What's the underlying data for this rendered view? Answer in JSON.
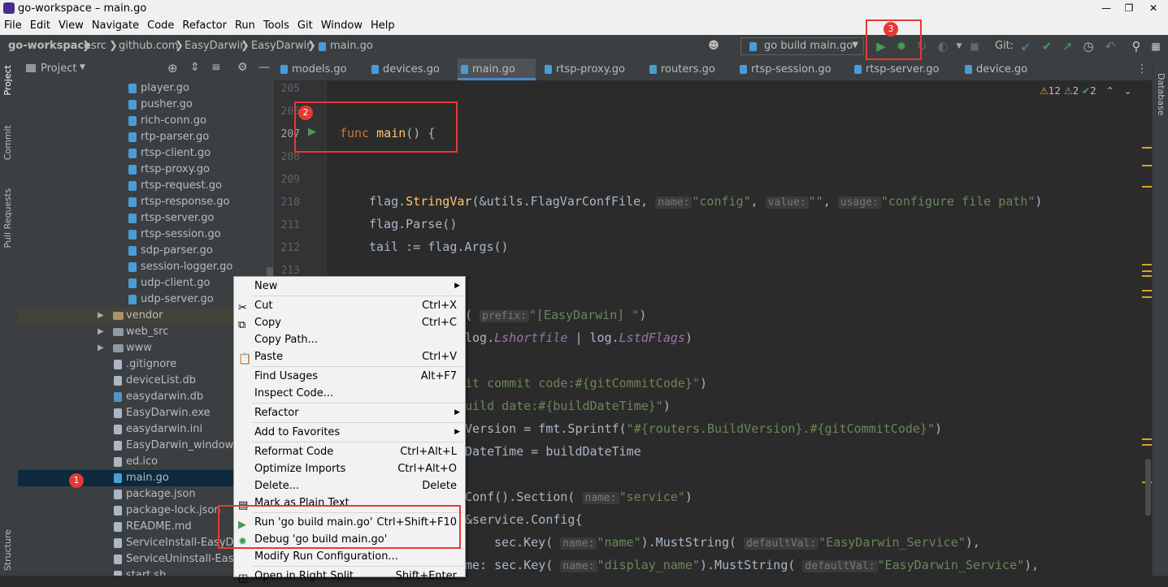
{
  "window": {
    "title": "go-workspace – main.go"
  },
  "menu": [
    "File",
    "Edit",
    "View",
    "Navigate",
    "Code",
    "Refactor",
    "Run",
    "Tools",
    "Git",
    "Window",
    "Help"
  ],
  "breadcrumb": [
    "go-workspace",
    "src",
    "github.com",
    "EasyDarwin",
    "EasyDarwin",
    "main.go"
  ],
  "toolbar": {
    "run_config": "go build main.go",
    "git_label": "Git:"
  },
  "left_stripe": [
    "Project",
    "Commit",
    "Pull Requests",
    "Structure"
  ],
  "right_stripe": [
    "Database"
  ],
  "project": {
    "title": "Project",
    "files_top": [
      "player.go",
      "pusher.go",
      "rich-conn.go",
      "rtp-parser.go",
      "rtsp-client.go",
      "rtsp-proxy.go",
      "rtsp-request.go",
      "rtsp-response.go",
      "rtsp-server.go",
      "rtsp-session.go",
      "sdp-parser.go",
      "session-logger.go",
      "udp-client.go",
      "udp-server.go"
    ],
    "folders": [
      "vendor",
      "web_src",
      "www"
    ],
    "files_bottom": [
      ".gitignore",
      "deviceList.db",
      "easydarwin.db",
      "EasyDarwin.exe",
      "easydarwin.ini",
      "EasyDarwin_windows.sy",
      "ed.ico",
      "main.go",
      "package.json",
      "package-lock.json",
      "README.md",
      "ServiceInstall-EasyDarv",
      "ServiceUninstall-EasyDa",
      "start.sh"
    ]
  },
  "tabs": [
    "models.go",
    "devices.go",
    "main.go",
    "rtsp-proxy.go",
    "routers.go",
    "rtsp-session.go",
    "rtsp-server.go",
    "device.go"
  ],
  "inspections": {
    "warnings_a": "12",
    "warnings_b": "2",
    "ok": "2"
  },
  "line_numbers": [
    "205",
    "206",
    "207",
    "208",
    "209",
    "210",
    "211",
    "212",
    "213"
  ],
  "code": {
    "l207_kw": "func",
    "l207_fn": "main",
    "l207_rest": "() {",
    "l210_a": "flag.",
    "l210_fn": "StringVar",
    "l210_b": "(&utils.FlagVarConfFile, ",
    "hint_name": "name:",
    "str_config": "\"config\"",
    "hint_value": "value:",
    "str_empty": "\"\"",
    "hint_usage": "usage:",
    "str_usage": "\"configure file path\"",
    "l211": "flag.Parse()",
    "l212": "tail := flag.Args()",
    "r1_a": "( ",
    "hint_prefix": "prefix:",
    "r1_str": "\"[EasyDarwin] \"",
    "r1_b": ")",
    "r2_a": "log.",
    "r2_it1": "Lshortfile",
    "r2_b": " | log.",
    "r2_it2": "LstdFlags",
    "r2_c": ")",
    "r3_str": "it commit code:#{gitCommitCode}\"",
    "r3_b": ")",
    "r4_str": "uild date:#{buildDateTime}\"",
    "r4_b": ")",
    "r5_a": "Version = fmt.Sprintf(",
    "r5_str": "\"#{routers.BuildVersion}.#{gitCommitCode}\"",
    "r5_b": ")",
    "r6": "DateTime = buildDateTime",
    "r7_a": "Conf().Section( ",
    "hint_name2": "name:",
    "r7_str": "\"service\"",
    "r7_b": ")",
    "r8": "&service.Config{",
    "r9_a": "sec.Key( ",
    "r9_hint": "name:",
    "r9_str": "\"name\"",
    "r9_b": ").MustString( ",
    "r9_hint2": "defaultVal:",
    "r9_str2": "\"EasyDarwin_Service\"",
    "r9_c": "),",
    "r10_a": "me: sec.Key( ",
    "r10_hint": "name:",
    "r10_str": "\"display_name\"",
    "r10_b": ").MustString( ",
    "r10_hint2": "defaultVal:",
    "r10_str2": "\"EasyDarwin_Service\"",
    "r10_c": "),"
  },
  "context_menu": [
    {
      "label": "New",
      "shortcut": "",
      "submenu": true
    },
    {
      "label": "Cut",
      "shortcut": "Ctrl+X"
    },
    {
      "label": "Copy",
      "shortcut": "Ctrl+C"
    },
    {
      "label": "Copy Path...",
      "shortcut": ""
    },
    {
      "label": "Paste",
      "shortcut": "Ctrl+V"
    },
    {
      "label": "Find Usages",
      "shortcut": "Alt+F7"
    },
    {
      "label": "Inspect Code...",
      "shortcut": ""
    },
    {
      "label": "Refactor",
      "shortcut": "",
      "submenu": true
    },
    {
      "label": "Add to Favorites",
      "shortcut": "",
      "submenu": true
    },
    {
      "label": "Reformat Code",
      "shortcut": "Ctrl+Alt+L"
    },
    {
      "label": "Optimize Imports",
      "shortcut": "Ctrl+Alt+O"
    },
    {
      "label": "Delete...",
      "shortcut": "Delete"
    },
    {
      "label": "Mark as Plain Text",
      "shortcut": ""
    },
    {
      "label": "Run 'go build main.go'",
      "shortcut": "Ctrl+Shift+F10"
    },
    {
      "label": "Debug 'go build main.go'",
      "shortcut": ""
    },
    {
      "label": "Modify Run Configuration...",
      "shortcut": ""
    },
    {
      "label": "Open in Right Split",
      "shortcut": "Shift+Enter"
    }
  ],
  "annotations": [
    "1",
    "2",
    "3"
  ],
  "colors": {
    "accent": "#e53935",
    "run_green": "#499c54",
    "selection": "#0d293e"
  }
}
